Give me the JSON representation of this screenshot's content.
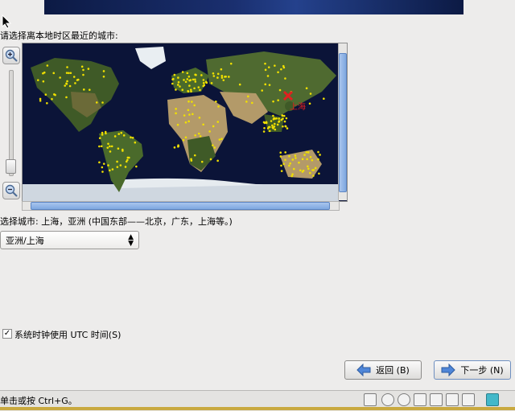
{
  "prompt_label": "请选择离本地时区最近的城市:",
  "map": {
    "selected_marker_label": "上海",
    "colors": {
      "ocean": "#0b1438",
      "land": "#3f5a27",
      "desert": "#b39a69",
      "city_dot": "#f0e000",
      "selected": "#e02020"
    }
  },
  "selected_city_text": "选择城市: 上海，亚洲 (中国东部——北京，广东，上海等。)",
  "timezone_select": {
    "value": "亚洲/上海"
  },
  "utc_checkbox": {
    "checked": true,
    "label": "系统时钟使用 UTC 时间(S)"
  },
  "buttons": {
    "back_label": "返回 (B)",
    "next_label": "下一步 (N)"
  },
  "status_text": "单击或按 Ctrl+G。",
  "icons": [
    "zoom-in-icon",
    "zoom-out-icon",
    "back-arrow-icon",
    "next-arrow-icon"
  ]
}
